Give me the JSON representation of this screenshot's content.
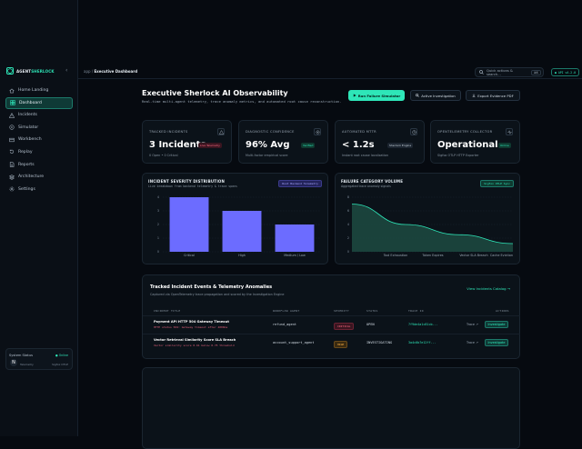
{
  "sidebar": {
    "brand_a": "AGENT",
    "brand_b": "SHERLOCK",
    "items": [
      {
        "label": "Home Landing",
        "icon": "home-icon"
      },
      {
        "label": "Dashboard",
        "icon": "dashboard-icon",
        "active": true
      },
      {
        "label": "Incidents",
        "icon": "alert-icon"
      },
      {
        "label": "Simulator",
        "icon": "simulator-icon"
      },
      {
        "label": "Workbench",
        "icon": "workbench-icon"
      },
      {
        "label": "Replay",
        "icon": "replay-icon"
      },
      {
        "label": "Reports",
        "icon": "reports-icon"
      },
      {
        "label": "Architecture",
        "icon": "architecture-icon"
      },
      {
        "label": "Settings",
        "icon": "gear-icon"
      }
    ],
    "status": {
      "title": "System Status",
      "online": "● Online",
      "row_label": "Telemetry",
      "row_value": "Sigfox OTLP",
      "avatar": "N"
    }
  },
  "topbar": {
    "crumb_root": "app",
    "crumb_sep": "/",
    "crumb_page": "Executive Dashboard",
    "search_placeholder": "Quick actions & search...",
    "search_kbd": "⌘K",
    "version": "● API v4.2.0"
  },
  "header": {
    "title": "Executive Sherlock AI Observability",
    "subtitle": "Real-time multi-agent telemetry, trace anomaly metrics, and automated root cause reconstruction.",
    "btn_run": "Run Failure Simulator",
    "btn_investigate": "Active Investigation",
    "btn_export": "Export Evidence PDF"
  },
  "kpis": [
    {
      "label": "TRACKED INCIDENTS",
      "value": "3 Incidents",
      "badge": "Live Telemetry",
      "desc": "0 Open • 0 Critical"
    },
    {
      "label": "DIAGNOSTIC CONFIDENCE",
      "value": "96% Avg",
      "badge": "Verified",
      "desc": "Multi-factor empirical score"
    },
    {
      "label": "AUTOMATED MTTR",
      "value": "< 1.2s",
      "badge": "Sherlock Engine",
      "desc": "Instant root cause localization"
    },
    {
      "label": "OPENTELEMETRY COLLECTOR",
      "value": "Operational",
      "badge": "Online",
      "desc": "Sigfox OTLP HTTP Exporter"
    }
  ],
  "severity_panel": {
    "title": "INCIDENT SEVERITY DISTRIBUTION",
    "subtitle": "Live breakdown from backend telemetry & trace spans",
    "tag": "Root Backend Telemetry"
  },
  "volume_panel": {
    "title": "FAILURE CATEGORY VOLUME",
    "subtitle": "Aggregated trace anomaly signals",
    "tag": "Sigfox OTLP Sync"
  },
  "chart_data": [
    {
      "type": "bar",
      "categories": [
        "Critical",
        "High",
        "Medium / Low"
      ],
      "values": [
        4,
        3,
        2
      ],
      "ylim": [
        0,
        4
      ],
      "yticks": [
        "0",
        "1",
        "2",
        "3",
        "4"
      ],
      "color": "#6c6cff",
      "grid": true
    },
    {
      "type": "area",
      "categories": [
        "Tool Exhaustion",
        "Token Expires",
        "Vector SLA Breach",
        "Cache Eviction"
      ],
      "values": [
        7,
        4,
        2.5,
        1.2
      ],
      "ylim": [
        0,
        8
      ],
      "yticks": [
        "0",
        "2",
        "4",
        "6",
        "8"
      ],
      "color": "#2ee6b8",
      "grid": true
    }
  ],
  "table": {
    "title": "Tracked Incident Events & Telemetry Anomalies",
    "subtitle": "Captured via OpenTelemetry trace propagation and scored by the Investigation Engine",
    "link": "View Incidents Catalog",
    "headers": [
      "INCIDENT TITLE",
      "WORKFLOW AGENT",
      "SEVERITY",
      "STATUS",
      "TRACE ID",
      "ACTIONS"
    ],
    "rows": [
      {
        "title": "Payment API HTTP 504 Gateway Timeout",
        "sub": "HTTP status 504: Gateway timeout after 4000ms",
        "agent": "refund_agent",
        "severity": "CRITICAL",
        "status": "OPEN",
        "trace": "7f9de4a1c81cb...",
        "trace_link": "Trace ↗",
        "action": "Investigate"
      },
      {
        "title": "Vector Retrieval Similarity Score SLA Breach",
        "sub": "Vector similarity score 0.61 below 0.75 threshold",
        "agent": "account_support_agent",
        "severity": "HIGH",
        "status": "INVESTIGATING",
        "trace": "3a4c0b7e12ff...",
        "trace_link": "Trace ↗",
        "action": "Investigate"
      }
    ]
  }
}
